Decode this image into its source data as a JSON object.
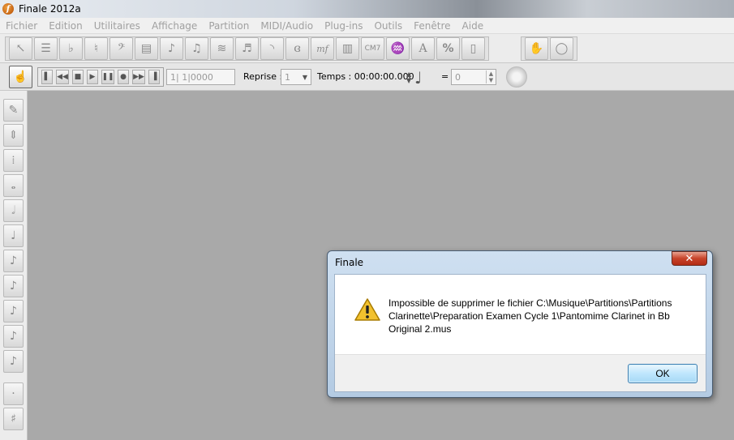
{
  "window": {
    "title": "Finale 2012a"
  },
  "menu": [
    "Fichier",
    "Edition",
    "Utilitaires",
    "Affichage",
    "Partition",
    "MIDI/Audio",
    "Plug-ins",
    "Outils",
    "Fenêtre",
    "Aide"
  ],
  "playback": {
    "position": "1| 1|0000",
    "repeat_label": "Reprise :",
    "repeat_value": "1",
    "time_label": "Temps : 00:00:00.000",
    "equals": "=",
    "tempo_value": "0"
  },
  "toolbar_glyphs": {
    "cm7": "CM7",
    "mf": "mf",
    "text_a": "A",
    "percent": "%"
  },
  "dialog": {
    "title": "Finale",
    "close": "✕",
    "message": "Impossible de supprimer le fichier C:\\Musique\\Partitions\\Partitions Clarinette\\Preparation Examen Cycle 1\\Pantomime Clarinet in Bb Original 2.mus",
    "ok": "OK"
  },
  "colors": {
    "workspace": "#a9a9a9",
    "close_button": "#c7432a",
    "ok_border": "#3c7fb1",
    "warning": "#f2c12e"
  }
}
